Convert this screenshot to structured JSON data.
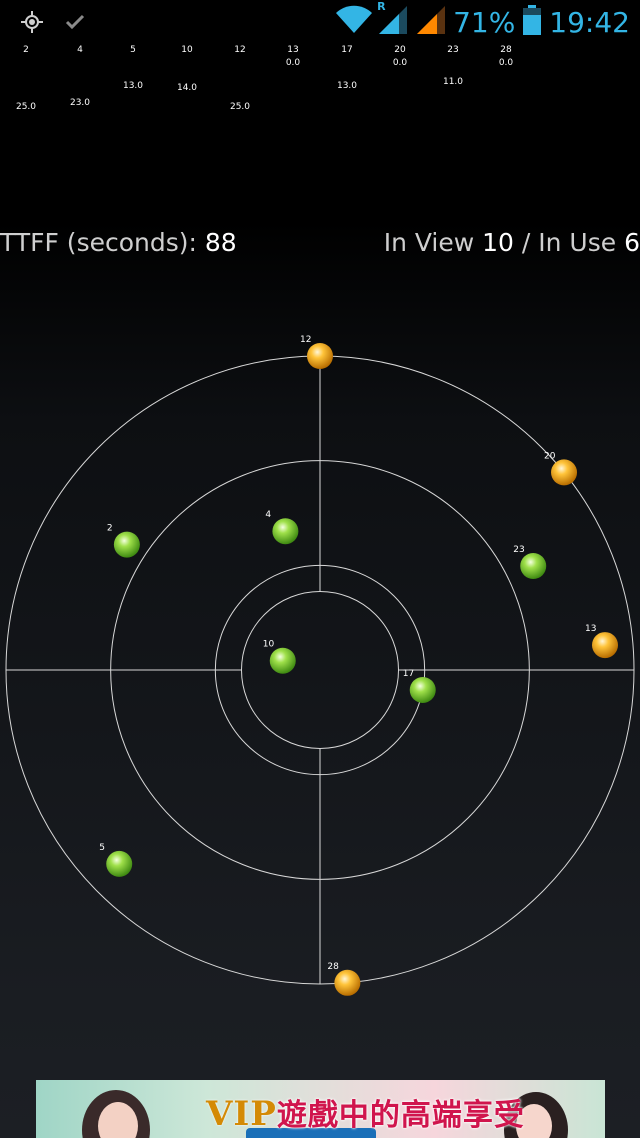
{
  "status_bar": {
    "left_icons": [
      "gps-icon",
      "check-icon"
    ],
    "right_icons": [
      "wifi-icon",
      "signal-roaming-icon",
      "signal-icon",
      "battery-icon"
    ],
    "roaming_label": "R",
    "battery_percent": "71%",
    "time": "19:42",
    "accent_color": "#33b5e5",
    "signal_orange": "#ff8800"
  },
  "snr_table": {
    "prns": [
      "2",
      "4",
      "5",
      "10",
      "12",
      "13",
      "17",
      "20",
      "23",
      "28"
    ],
    "row1": [
      "",
      "",
      "",
      "",
      "",
      "0.0",
      "",
      "0.0",
      "",
      "0.0"
    ],
    "row2": [
      "",
      "",
      "13.0",
      "14.0",
      "",
      "",
      "13.0",
      "",
      "11.0",
      ""
    ],
    "row3": [
      "25.0",
      "23.0",
      "",
      "",
      "25.0",
      "",
      "",
      "",
      "",
      ""
    ]
  },
  "info": {
    "ttff_label": "TTFF (seconds): ",
    "ttff_value": "88",
    "inview_label": "In View ",
    "inview_value": "10",
    "inuse_label": " / In Use ",
    "inuse_value": "6"
  },
  "sky_plot": {
    "satellites": [
      {
        "prn": "12",
        "azimuth": 0,
        "elevation": 0,
        "used": false
      },
      {
        "prn": "20",
        "azimuth": 51,
        "elevation": 0,
        "used": false
      },
      {
        "prn": "23",
        "azimuth": 64,
        "elevation": 22,
        "used": true
      },
      {
        "prn": "4",
        "azimuth": 346,
        "elevation": 49,
        "used": true
      },
      {
        "prn": "2",
        "azimuth": 303,
        "elevation": 24,
        "used": true
      },
      {
        "prn": "13",
        "azimuth": 85,
        "elevation": 8,
        "used": false
      },
      {
        "prn": "10",
        "azimuth": 284,
        "elevation": 79,
        "used": true
      },
      {
        "prn": "17",
        "azimuth": 101,
        "elevation": 60,
        "used": true
      },
      {
        "prn": "5",
        "azimuth": 226,
        "elevation": 10,
        "used": true
      },
      {
        "prn": "28",
        "azimuth": 175,
        "elevation": 0,
        "used": false
      }
    ],
    "used_color": "#7fd23a",
    "unused_color": "#f0a810",
    "ring_color": "#d8d8d8"
  },
  "ad_banner": {
    "vip_text": "VIP",
    "headline": "遊戲中的高端享受"
  }
}
